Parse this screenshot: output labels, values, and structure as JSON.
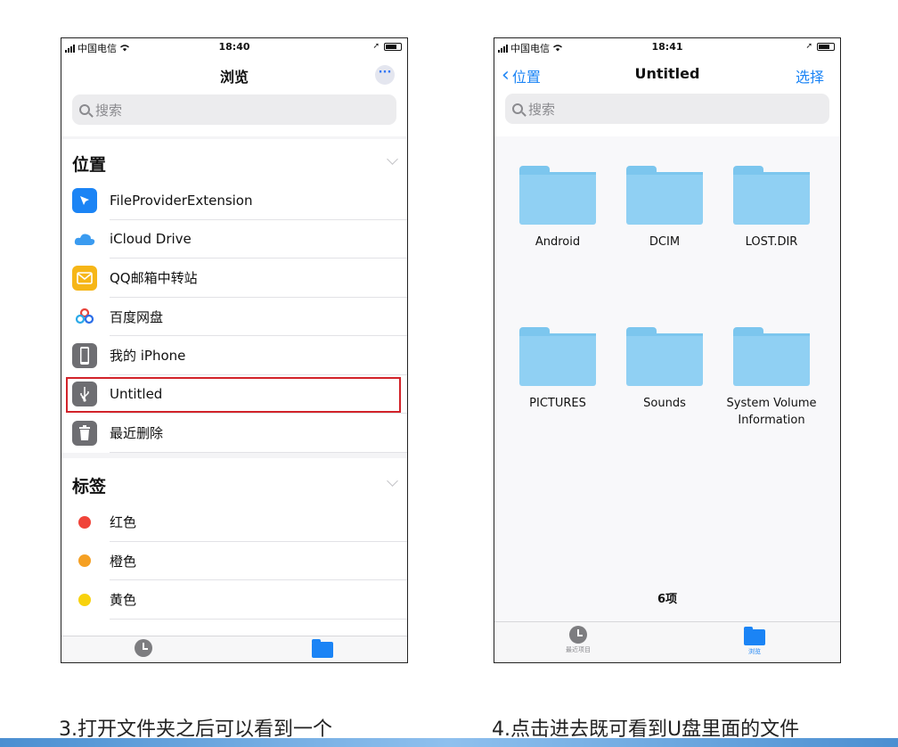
{
  "status_left": {
    "carrier": "中国电信",
    "time": "18:40"
  },
  "status_right": {
    "carrier": "中国电信",
    "time": "18:41"
  },
  "left_screen": {
    "title": "浏览",
    "more_glyph": "···",
    "search_placeholder": "搜索",
    "locations_header": "位置",
    "locations": [
      {
        "label": "FileProviderExtension",
        "icon": "file-provider-icon"
      },
      {
        "label": "iCloud Drive",
        "icon": "icloud-icon"
      },
      {
        "label": "QQ邮箱中转站",
        "icon": "mail-icon"
      },
      {
        "label": "百度网盘",
        "icon": "baidu-netdisk-icon"
      },
      {
        "label": "我的 iPhone",
        "icon": "iphone-icon"
      },
      {
        "label": "Untitled",
        "icon": "usb-icon"
      },
      {
        "label": "最近删除",
        "icon": "trash-icon"
      }
    ],
    "tags_header": "标签",
    "tags": [
      {
        "label": "红色",
        "color": "#f0443a"
      },
      {
        "label": "橙色",
        "color": "#f5a023"
      },
      {
        "label": "黄色",
        "color": "#f8d20d"
      }
    ],
    "tabs": {
      "recents": "最近项目",
      "browse": "浏览"
    }
  },
  "right_screen": {
    "back_label": "位置",
    "title": "Untitled",
    "select_label": "选择",
    "search_placeholder": "搜索",
    "folders": [
      "Android",
      "DCIM",
      "LOST.DIR",
      "PICTURES",
      "Sounds",
      "System Volume Information"
    ],
    "count": "6项",
    "tabs": {
      "recents": "最近项目",
      "browse": "浏览"
    }
  },
  "captions": {
    "left": "3.打开文件夹之后可以看到一个",
    "right": "4.点击进去既可看到U盘里面的文件"
  },
  "colors": {
    "accent": "#1b84f5",
    "highlight": "#d2232a",
    "folder": "#90d0f3"
  }
}
